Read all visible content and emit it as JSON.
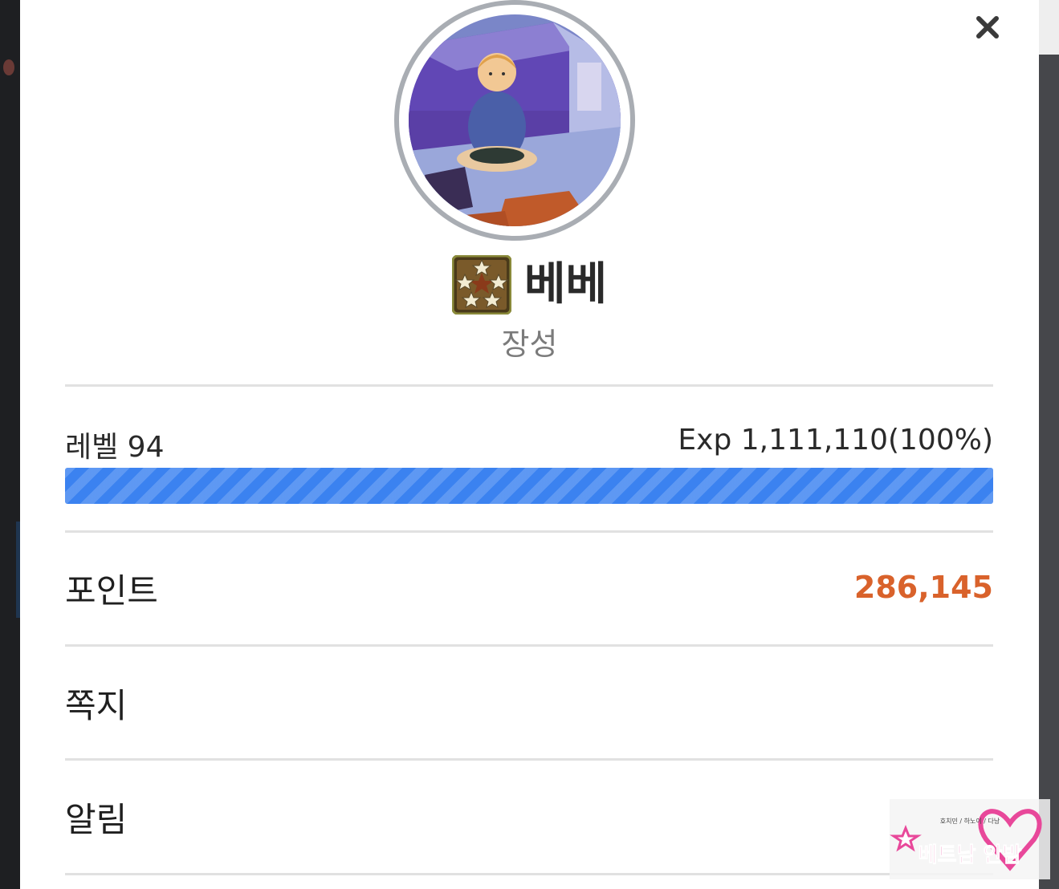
{
  "profile": {
    "nickname": "베베",
    "rank_title": "장성",
    "avatar_icon": "avatar-image",
    "rank_badge_icon": "five-star-badge-icon"
  },
  "level": {
    "label": "레벨 94",
    "exp_text": "Exp 1,111,110(100%)",
    "progress_fraction": 1.0
  },
  "menu": {
    "points_label": "포인트",
    "points_value": "286,145",
    "messages_label": "쪽지",
    "notifications_label": "알림"
  },
  "watermark": {
    "text": "베트남 안밤",
    "small_text": "호치민 / 하노이 / 다낭"
  },
  "colors": {
    "progress_bar": "#3b82f0",
    "points_value": "#d9622b",
    "avatar_ring": "#a9adb3",
    "watermark_pink": "#e8489a"
  }
}
